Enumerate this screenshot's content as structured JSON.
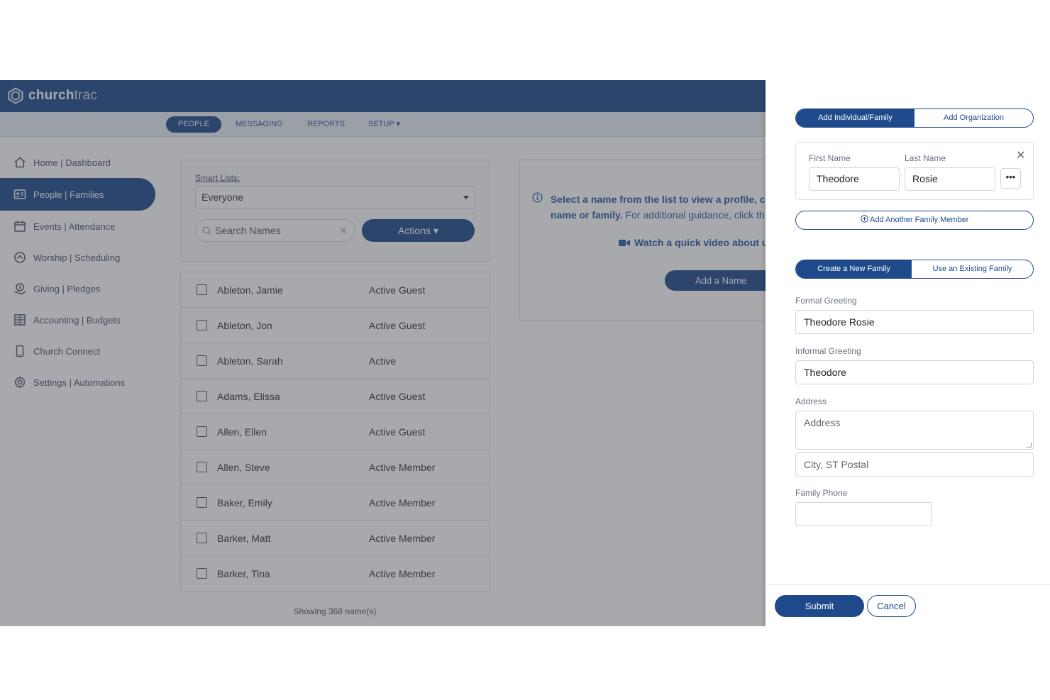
{
  "brand": {
    "name_bold": "church",
    "name_light": "trac"
  },
  "nav": {
    "items": [
      {
        "label": "PEOPLE"
      },
      {
        "label": "MESSAGING"
      },
      {
        "label": "REPORTS"
      },
      {
        "label": "SETUP ▾"
      }
    ]
  },
  "sidebar": {
    "items": [
      {
        "label": "Home | Dashboard",
        "icon": "home-icon"
      },
      {
        "label": "People | Families",
        "icon": "id-card-icon"
      },
      {
        "label": "Events | Attendance",
        "icon": "calendar-icon"
      },
      {
        "label": "Worship | Scheduling",
        "icon": "music-icon"
      },
      {
        "label": "Giving | Pledges",
        "icon": "giving-icon"
      },
      {
        "label": "Accounting | Budgets",
        "icon": "ledger-icon"
      },
      {
        "label": "Church Connect",
        "icon": "phone-icon"
      },
      {
        "label": "Settings | Automations",
        "icon": "gear-icon"
      }
    ]
  },
  "filters": {
    "smart_lists_label": "Smart Lists:",
    "smart_list_value": "Everyone",
    "search_placeholder": "Search Names",
    "actions_label": "Actions ▾"
  },
  "people": [
    {
      "name": "Ableton, Jamie",
      "status": "Active Guest"
    },
    {
      "name": "Ableton, Jon",
      "status": "Active Guest"
    },
    {
      "name": "Ableton, Sarah",
      "status": "Active"
    },
    {
      "name": "Adams, Elissa",
      "status": "Active Guest"
    },
    {
      "name": "Allen, Ellen",
      "status": "Active Guest"
    },
    {
      "name": "Allen, Steve",
      "status": "Active Member"
    },
    {
      "name": "Baker, Emily",
      "status": "Active Member"
    },
    {
      "name": "Barker, Matt",
      "status": "Active Member"
    },
    {
      "name": "Barker, Tina",
      "status": "Active Member"
    }
  ],
  "showing_text": "Showing 368 name(s)",
  "info": {
    "bold_1": "Select a name from the list to view a profile, c",
    "bold_2": "name or family.",
    "rest_2": " For additional guidance, click th",
    "video_text": "Watch a quick video about u",
    "add_name_label": "Add a Name"
  },
  "panel": {
    "type_tabs": [
      "Add Individual/Family",
      "Add Organization"
    ],
    "first_name_label": "First Name",
    "last_name_label": "Last Name",
    "first_name_value": "Theodore",
    "last_name_value": "Rosie",
    "more_label": "•••",
    "close_label": "✕",
    "add_member_label": "Add Another Family Member",
    "family_tabs": [
      "Create a New Family",
      "Use an Existing Family"
    ],
    "formal_greeting_label": "Formal Greeting",
    "formal_greeting_value": "Theodore  Rosie",
    "informal_greeting_label": "Informal Greeting",
    "informal_greeting_value": "Theodore",
    "address_label": "Address",
    "address_placeholder": "Address",
    "city_placeholder": "City, ST Postal",
    "family_phone_label": "Family Phone",
    "family_phone_value": "",
    "submit_label": "Submit",
    "cancel_label": "Cancel"
  },
  "colors": {
    "brand_blue": "#1e4a8c",
    "link_blue": "#2a5aa8"
  }
}
